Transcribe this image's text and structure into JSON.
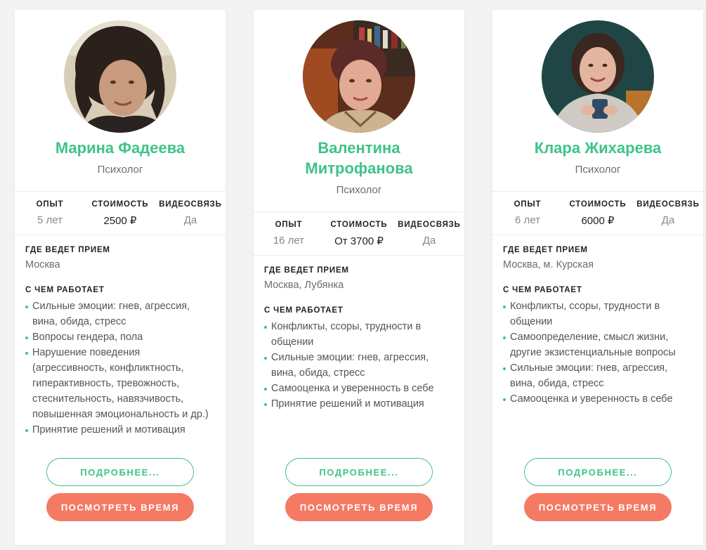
{
  "labels": {
    "experience": "ОПЫТ",
    "price": "СТОИМОСТЬ",
    "video": "ВИДЕОСВЯЗЬ",
    "location": "ГДЕ ВЕДЕТ ПРИЕМ",
    "topics": "С ЧЕМ РАБОТАЕТ",
    "more_button": "ПОДРОБНЕЕ...",
    "time_button": "ПОСМОТРЕТЬ ВРЕМЯ"
  },
  "colors": {
    "accent_green": "#3fc38a",
    "accent_coral": "#f47a63"
  },
  "cards": [
    {
      "name": "Марина Фадеева",
      "role": "Психолог",
      "experience": "5 лет",
      "price": "2500 ₽",
      "video": "Да",
      "location": "Москва",
      "topics": [
        "Сильные эмоции: гнев, агрессия, вина, обида, стресс",
        "Вопросы гендера, пола",
        "Нарушение поведения (агрессивность, конфликтность, гиперактивность, тревожность, стеснительность, навязчивость, повышенная эмоциональность и др.)",
        "Принятие решений и мотивация"
      ]
    },
    {
      "name": "Валентина Митрофанова",
      "role": "Психолог",
      "experience": "16 лет",
      "price": "От 3700 ₽",
      "video": "Да",
      "location": "Москва, Лубянка",
      "topics": [
        "Конфликты, ссоры, трудности в общении",
        "Сильные эмоции: гнев, агрессия, вина, обида, стресс",
        "Самооценка и уверенность в себе",
        "Принятие решений и мотивация"
      ]
    },
    {
      "name": "Клара Жихарева",
      "role": "Психолог",
      "experience": "6 лет",
      "price": "6000 ₽",
      "video": "Да",
      "location": "Москва, м. Курская",
      "topics": [
        "Конфликты, ссоры, трудности в общении",
        "Самоопределение, смысл жизни, другие экзистенциальные вопросы",
        "Сильные эмоции: гнев, агрессия, вина, обида, стресс",
        "Самооценка и уверенность в себе"
      ]
    }
  ]
}
